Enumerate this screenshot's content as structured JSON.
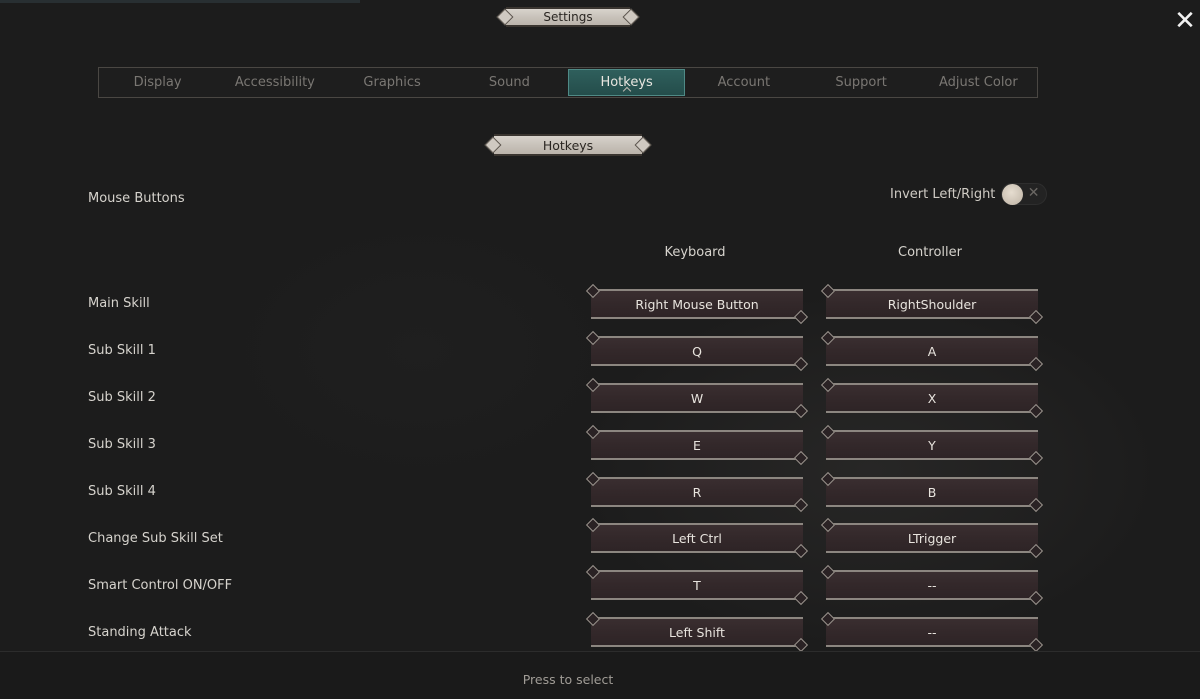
{
  "window": {
    "title": "Settings",
    "close_icon": "close-icon"
  },
  "tabs": [
    {
      "label": "Display",
      "active": false
    },
    {
      "label": "Accessibility",
      "active": false
    },
    {
      "label": "Graphics",
      "active": false
    },
    {
      "label": "Sound",
      "active": false
    },
    {
      "label": "Hotkeys",
      "active": true
    },
    {
      "label": "Account",
      "active": false
    },
    {
      "label": "Support",
      "active": false
    },
    {
      "label": "Adjust Color",
      "active": false
    }
  ],
  "section": {
    "title": "Hotkeys",
    "mouse_buttons_label": "Mouse Buttons",
    "invert": {
      "label": "Invert Left/Right",
      "enabled": false,
      "off_icon": "x-icon"
    },
    "columns": {
      "keyboard": "Keyboard",
      "controller": "Controller"
    }
  },
  "bindings": [
    {
      "action": "Main Skill",
      "keyboard": "Right Mouse Button",
      "controller": "RightShoulder"
    },
    {
      "action": "Sub Skill 1",
      "keyboard": "Q",
      "controller": "A"
    },
    {
      "action": "Sub Skill 2",
      "keyboard": "W",
      "controller": "X"
    },
    {
      "action": "Sub Skill 3",
      "keyboard": "E",
      "controller": "Y"
    },
    {
      "action": "Sub Skill 4",
      "keyboard": "R",
      "controller": "B"
    },
    {
      "action": "Change Sub Skill Set",
      "keyboard": "Left Ctrl",
      "controller": "LTrigger"
    },
    {
      "action": "Smart Control ON/OFF",
      "keyboard": "T",
      "controller": "--"
    },
    {
      "action": "Standing Attack",
      "keyboard": "Left Shift",
      "controller": "--"
    }
  ],
  "footer": {
    "hint": "Press to select"
  },
  "colors": {
    "background": "#1c1c1c",
    "active_tab": "#2f5f5c",
    "slot_bg": "#33282a",
    "plaque": "#cfc9c1"
  }
}
